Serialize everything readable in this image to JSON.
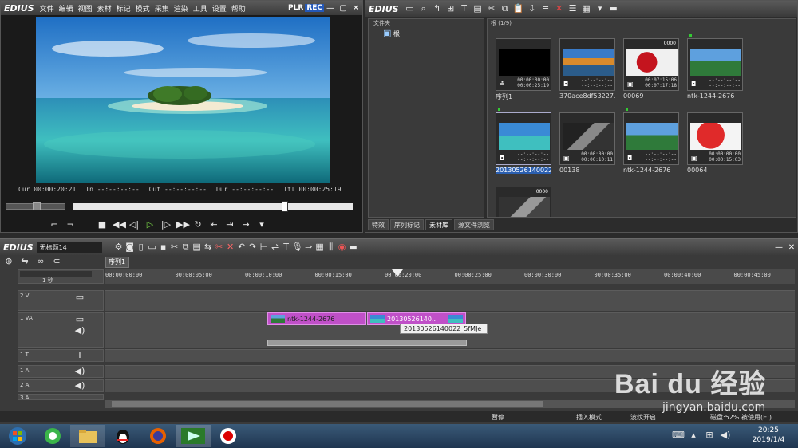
{
  "player": {
    "logo": "EDIUS",
    "menu": [
      "文件",
      "编辑",
      "视图",
      "素材",
      "标记",
      "模式",
      "采集",
      "渲染",
      "工具",
      "设置",
      "帮助"
    ],
    "plr": "PLR",
    "rec": "REC",
    "timecodes": {
      "cur_label": "Cur",
      "cur": "00:00:20:21",
      "in_label": "In",
      "in": "--:--:--:--",
      "out_label": "Out",
      "out": "--:--:--:--",
      "dur_label": "Dur",
      "dur": "--:--:--:--",
      "ttl_label": "Ttl",
      "ttl": "00:00:25:19"
    }
  },
  "bin": {
    "logo": "EDIUS",
    "folder_header": "文件夹",
    "root_label": "根",
    "clip_header": "根 (1/9)",
    "clips": [
      {
        "name": "序列1",
        "tc": "00:00:00:00\n00:00:25:19",
        "kind": "sequence",
        "badge": ""
      },
      {
        "name": "370ace8df53227...",
        "tc": "--:--:--:--\n--:--:--:--",
        "kind": "still",
        "badge": ""
      },
      {
        "name": "00069",
        "tc": "00:07:15:06\n00:07:17:18",
        "kind": "video",
        "badge": "0000"
      },
      {
        "name": "ntk-1244-2676",
        "tc": "--:--:--:--\n--:--:--:--",
        "kind": "still",
        "badge": ""
      },
      {
        "name": "20130526140022...",
        "tc": "--:--:--:--\n--:--:--:--",
        "kind": "still",
        "badge": ""
      },
      {
        "name": "00138",
        "tc": "00:00:00:00\n00:00:10:11",
        "kind": "video",
        "badge": ""
      },
      {
        "name": "ntk-1244-2676",
        "tc": "--:--:--:--\n--:--:--:--",
        "kind": "still",
        "badge": ""
      },
      {
        "name": "00064",
        "tc": "00:00:00:00\n00:00:15:03",
        "kind": "video",
        "badge": ""
      },
      {
        "name": "",
        "tc": "",
        "kind": "video",
        "badge": "0000"
      }
    ],
    "tabs": [
      "特效",
      "序列标记",
      "素材库",
      "源文件浏览"
    ]
  },
  "timeline": {
    "logo": "EDIUS",
    "project": "无标题14",
    "sequence_tab": "序列1",
    "zoom_label": "1 秒",
    "ruler": [
      "00:00:00:00",
      "00:00:05:00",
      "00:00:10:00",
      "00:00:15:00",
      "00:00:20:00",
      "00:00:25:00",
      "00:00:30:00",
      "00:00:35:00",
      "00:00:40:00",
      "00:00:45:00"
    ],
    "tracks": {
      "v2": "2 V",
      "va1": "1 VA",
      "t1": "1 T",
      "a1": "1 A",
      "a2": "2 A",
      "a3": "3 A"
    },
    "clip1_label": "ntk-1244-2676",
    "clip2_label": "20130526140...",
    "tooltip": "20130526140022_5fMJe",
    "status": {
      "pause": "暂停",
      "insert_mode": "插入模式",
      "ripple": "波纹开启",
      "disk": "磁盘:52% 被使用(E:)"
    }
  },
  "taskbar": {
    "time": "20:25",
    "date": "2019/1/4",
    "items": [
      "start-orb",
      "360-browser",
      "file-explorer",
      "qq",
      "firefox",
      "edius",
      "record"
    ]
  },
  "watermark": {
    "brand": "Bai du 经验",
    "url": "jingyan.baidu.com"
  }
}
